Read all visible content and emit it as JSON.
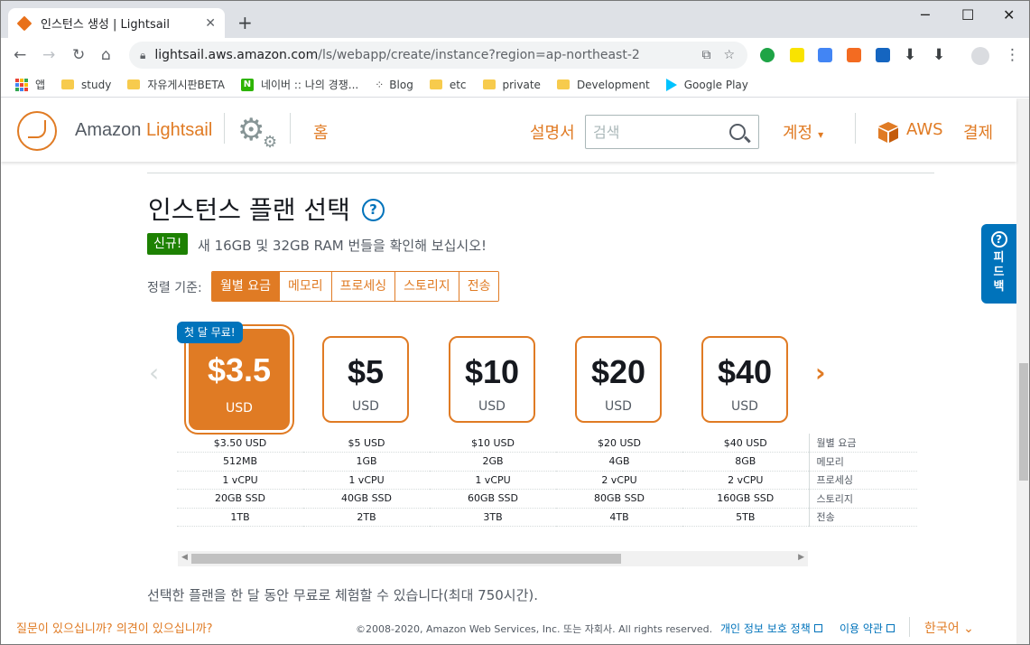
{
  "browser": {
    "tab_title": "인스턴스 생성 | Lightsail",
    "url_host": "lightsail.aws.amazon.com",
    "url_path": "/ls/webapp/create/instance?region=ap-northeast-2",
    "bookmarks": [
      {
        "label": "앱",
        "icon": "apps-icon"
      },
      {
        "label": "study",
        "icon": "folder-icon"
      },
      {
        "label": "자유게시판BETA",
        "icon": "folder-icon"
      },
      {
        "label": "네이버 :: 나의 경쟁...",
        "icon": "naver-icon"
      },
      {
        "label": "Blog",
        "icon": "blog-icon"
      },
      {
        "label": "etc",
        "icon": "folder-icon"
      },
      {
        "label": "private",
        "icon": "folder-icon"
      },
      {
        "label": "Development",
        "icon": "folder-icon"
      },
      {
        "label": "Google Play",
        "icon": "google-play-icon"
      }
    ]
  },
  "header": {
    "logo_prefix": "Amazon ",
    "logo_product": "Lightsail",
    "home": "홈",
    "docs": "설명서",
    "search_placeholder": "검색",
    "account": "계정",
    "aws": "AWS",
    "billing": "결제"
  },
  "plans": {
    "heading": "인스턴스 플랜 선택",
    "help": "?",
    "new_badge": "신규!",
    "new_text": "새 16GB 및 32GB RAM 번들을 확인해 보십시오!",
    "sort_label": "정렬 기준:",
    "sort_options": [
      "월별 요금",
      "메모리",
      "프로세싱",
      "스토리지",
      "전송"
    ],
    "free_badge": "첫 달 무료!",
    "cards": [
      {
        "price": "$3.5",
        "currency": "USD",
        "selected": true
      },
      {
        "price": "$5",
        "currency": "USD",
        "selected": false
      },
      {
        "price": "$10",
        "currency": "USD",
        "selected": false
      },
      {
        "price": "$20",
        "currency": "USD",
        "selected": false
      },
      {
        "price": "$40",
        "currency": "USD",
        "selected": false
      }
    ],
    "spec_rows": [
      {
        "label": "월별 요금",
        "values": [
          "$3.50 USD",
          "$5 USD",
          "$10 USD",
          "$20 USD",
          "$40 USD"
        ]
      },
      {
        "label": "메모리",
        "values": [
          "512MB",
          "1GB",
          "2GB",
          "4GB",
          "8GB"
        ]
      },
      {
        "label": "프로세싱",
        "values": [
          "1 vCPU",
          "1 vCPU",
          "1 vCPU",
          "2 vCPU",
          "2 vCPU"
        ]
      },
      {
        "label": "스토리지",
        "values": [
          "20GB SSD",
          "40GB SSD",
          "60GB SSD",
          "80GB SSD",
          "160GB SSD"
        ]
      },
      {
        "label": "전송",
        "values": [
          "1TB",
          "2TB",
          "3TB",
          "4TB",
          "5TB"
        ]
      }
    ],
    "trial_text": "선택한 플랜을 한 달 동안 무료로 체험할 수 있습니다(최대 750시간)."
  },
  "feedback": {
    "label": "피드백"
  },
  "footer": {
    "question": "질문이 있으십니까? 의견이 있으십니까?",
    "copyright": "©2008-2020, Amazon Web Services, Inc. 또는 자회사. All rights reserved.",
    "privacy": "개인 정보 보호 정책",
    "terms": "이용 약관",
    "language": "한국어"
  },
  "colors": {
    "accent": "#e07b24",
    "link": "#0073bb",
    "new_green": "#1d8102"
  }
}
